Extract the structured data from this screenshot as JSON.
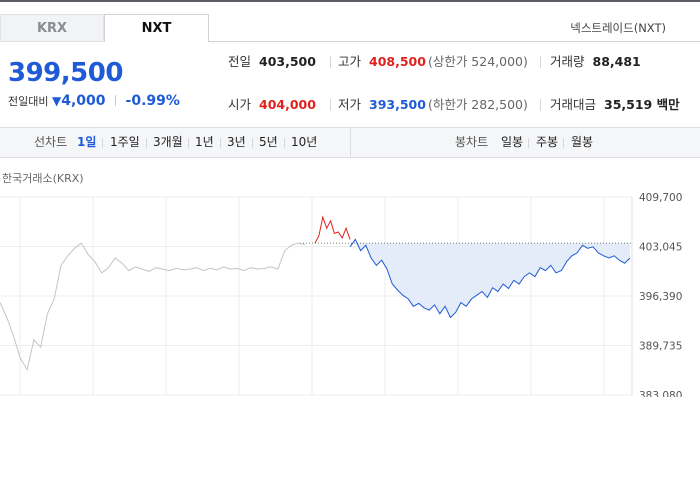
{
  "tabs": {
    "krx": "KRX",
    "nxt": "NXT",
    "active": "NXT"
  },
  "venue_label": "넥스트레이드(NXT)",
  "price": {
    "current": "399,500",
    "change_label": "전일대비",
    "change_arrow": "▼",
    "change_value": "4,000",
    "change_pct": "-0.99%"
  },
  "stats": {
    "prev_close": {
      "label": "전일",
      "value": "403,500"
    },
    "high": {
      "label": "고가",
      "value": "408,500",
      "sub": "(상한가 524,000)"
    },
    "volume": {
      "label": "거래량",
      "value": "88,481"
    },
    "open": {
      "label": "시가",
      "value": "404,000"
    },
    "low": {
      "label": "저가",
      "value": "393,500",
      "sub": "(하한가 282,500)"
    },
    "amount": {
      "label": "거래대금",
      "value": "35,519 백만"
    }
  },
  "period_bar": {
    "line_label": "선차트",
    "periods": [
      "1일",
      "1주일",
      "3개월",
      "1년",
      "3년",
      "5년",
      "10년"
    ],
    "active_period": "1일",
    "candle_label": "봉차트",
    "candle_periods": [
      "일봉",
      "주봉",
      "월봉"
    ]
  },
  "chart_source": "한국거래소(KRX)",
  "colors": {
    "rise": "#e0221e",
    "fall": "#1f5bd6",
    "accent": "#1f5bd6",
    "krx_line": "#c4c4c4",
    "fill": "#e3ecf8"
  },
  "chart_data": {
    "type": "line",
    "y_ticks": [
      "409,700",
      "403,045",
      "396,390",
      "389,735",
      "383,080"
    ],
    "y_values": [
      409700,
      403045,
      396390,
      389735,
      383080
    ],
    "ylim": [
      383080,
      409700
    ],
    "baseline": 403500,
    "grid": true,
    "series": [
      {
        "values": [
          395500,
          393500,
          391000,
          388000,
          386500,
          390500,
          389500,
          394000,
          396000,
          400500,
          401800,
          402800,
          403500,
          402000,
          401000,
          399500,
          400200,
          401500,
          400800,
          399800,
          400300,
          400000,
          399700,
          400200,
          400000,
          399800,
          400100,
          399900,
          400000,
          400200,
          399800,
          400100,
          399900,
          400300,
          400000,
          400100,
          399800,
          400200,
          400000,
          400100,
          400300,
          400000,
          402500,
          403200,
          403500,
          403300
        ]
      },
      {
        "values": [
          403500,
          404500,
          407000,
          405500,
          406500,
          404800,
          405000,
          404200,
          405500,
          404000
        ]
      },
      {
        "values": [
          403000,
          404000,
          402500,
          403200,
          401500,
          400500,
          401200,
          400000,
          398000,
          397200,
          396500,
          396000,
          395000,
          395400,
          394800,
          394500,
          395200,
          394000,
          395000,
          393500,
          394200,
          395500,
          395000,
          396000,
          396500,
          397000,
          396200,
          397500,
          397000,
          398000,
          397400,
          398500,
          398000,
          399000,
          399500,
          399000,
          400200,
          399800,
          400500,
          399500,
          399800,
          401000,
          401800,
          402200,
          403200,
          402800,
          403000,
          402200,
          401800,
          401500,
          401800,
          401200,
          400800,
          401500
        ]
      }
    ]
  }
}
